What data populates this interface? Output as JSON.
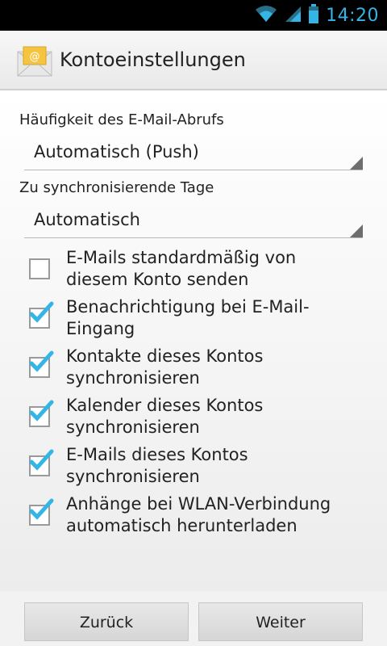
{
  "status": {
    "time": "14:20",
    "wifi_icon": "wifi-icon",
    "signal_icon": "signal-icon",
    "battery_icon": "battery-icon"
  },
  "header": {
    "title": "Kontoeinstellungen",
    "icon": "email-envelope-icon"
  },
  "settings": {
    "frequency_label": "Häufigkeit des E-Mail-Abrufs",
    "frequency_value": "Automatisch (Push)",
    "days_label": "Zu synchronisierende Tage",
    "days_value": "Automatisch"
  },
  "options": [
    {
      "line1": "E-Mails standardmäßig von",
      "line2": "diesem Konto senden",
      "checked": false
    },
    {
      "line1": "Benachrichtigung bei E-Mail-",
      "line2": "Eingang",
      "checked": true
    },
    {
      "line1": "Kontakte dieses Kontos",
      "line2": "synchronisieren",
      "checked": true
    },
    {
      "line1": "Kalender dieses Kontos",
      "line2": "synchronisieren",
      "checked": true
    },
    {
      "line1": "E-Mails dieses Kontos",
      "line2": "synchronisieren",
      "checked": true
    },
    {
      "line1": "Anhänge bei WLAN-Verbindung",
      "line2": "automatisch herunterladen",
      "checked": true
    }
  ],
  "buttons": {
    "back": "Zurück",
    "next": "Weiter"
  },
  "colors": {
    "accent": "#33b5e5",
    "check": "#33b5e5"
  }
}
